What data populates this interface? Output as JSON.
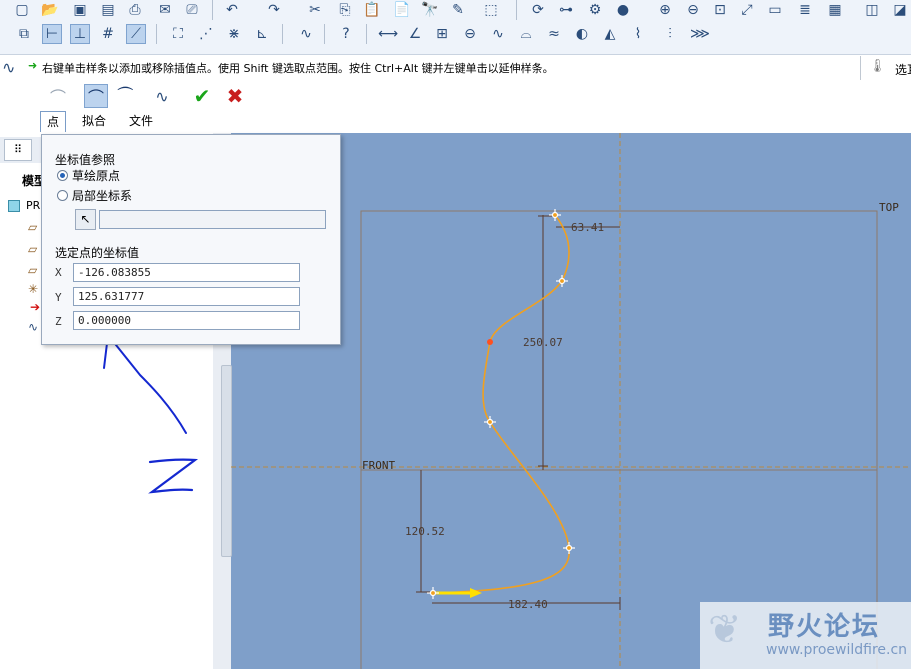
{
  "message": {
    "text": "右键单击样条以添加或移除插值点。使用 Shift 键选取点范围。按住 Ctrl+Alt 键并左键单击以延伸样条。",
    "right_text": "选耳"
  },
  "dashboard": {
    "tabs": [
      "点",
      "拟合",
      "文件"
    ]
  },
  "left_panel": {
    "tree_header": "模型",
    "tree_root": "PR"
  },
  "popup": {
    "ref_title": "坐标值参照",
    "opt_sketch_origin": "草绘原点",
    "opt_local_csys": "局部坐标系",
    "coords_title": "选定点的坐标值",
    "x_label": "X",
    "x_value": "-126.083855",
    "y_label": "Y",
    "y_value": "125.631777",
    "z_label": "Z",
    "z_value": "0.000000"
  },
  "sketch": {
    "top_label": "TOP",
    "front_label": "FRONT",
    "dim_63": "63.41",
    "dim_250": "250.07",
    "dim_120": "120.52",
    "dim_182": "182.40"
  },
  "annotation": {
    "handwritten": "Z"
  },
  "watermark": {
    "title": "野火论坛",
    "url": "www.proewildfire.cn"
  },
  "colors": {
    "canvas": "#7f9fc9",
    "spline": "#f0a020",
    "dims": "#5a3a2a",
    "annotation": "#1428d0",
    "accept": "#1aa51a",
    "cancel": "#c81e1e"
  }
}
